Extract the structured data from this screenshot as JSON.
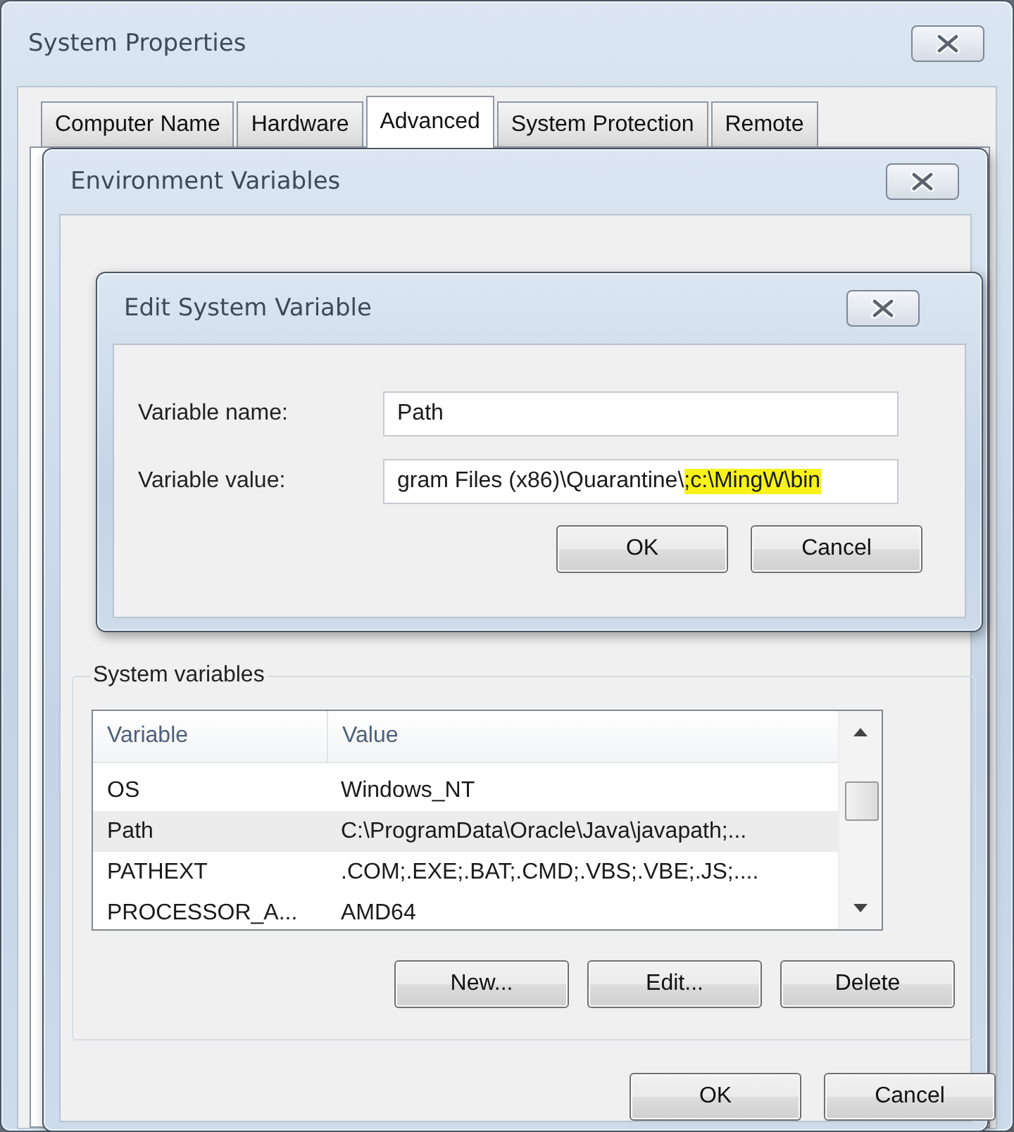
{
  "window": {
    "title": "System Properties",
    "tabs": [
      {
        "label": "Computer Name",
        "selected": false
      },
      {
        "label": "Hardware",
        "selected": false
      },
      {
        "label": "Advanced",
        "selected": true
      },
      {
        "label": "System Protection",
        "selected": false
      },
      {
        "label": "Remote",
        "selected": false
      }
    ]
  },
  "environment_window": {
    "title": "Environment Variables",
    "system_variables": {
      "title": "System variables",
      "columns": [
        "Variable",
        "Value"
      ],
      "rows": [
        {
          "variable": "OS",
          "value": "Windows_NT",
          "selected": false
        },
        {
          "variable": "Path",
          "value": "C:\\ProgramData\\Oracle\\Java\\javapath;...",
          "selected": true
        },
        {
          "variable": "PATHEXT",
          "value": ".COM;.EXE;.BAT;.CMD;.VBS;.VBE;.JS;....",
          "selected": false
        },
        {
          "variable": "PROCESSOR_A...",
          "value": "AMD64",
          "selected": false
        }
      ],
      "buttons": [
        "New...",
        "Edit...",
        "Delete"
      ]
    },
    "buttons": [
      "OK",
      "Cancel"
    ]
  },
  "edit_dialog": {
    "title": "Edit System Variable",
    "fields": [
      {
        "label": "Variable name:",
        "value": [
          {
            "text": "Path",
            "highlighted": false
          }
        ]
      },
      {
        "label": "Variable value:",
        "value": [
          {
            "text": "gram Files (x86)\\Quarantine\\",
            "highlighted": false
          },
          {
            "text": ";c:\\MingW\\bin",
            "highlighted": true
          }
        ]
      }
    ],
    "buttons": [
      "OK",
      "Cancel"
    ]
  }
}
